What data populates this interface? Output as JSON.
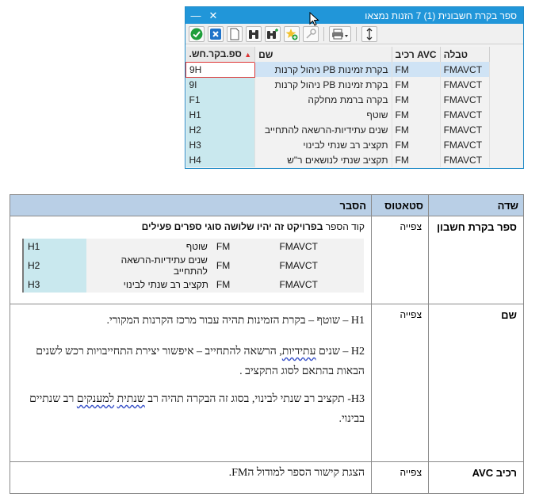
{
  "popup": {
    "title": "ספר בקרת חשבונית (1)   7 הזנות נמצאו",
    "grid": {
      "headers": {
        "code": ".ספ.בקר.חש",
        "name": "שם",
        "avc": "רכיב AVC",
        "table": "טבלה"
      },
      "rows": [
        {
          "code": "9H",
          "name": "ניהול קרנות PB בקרת זמינות",
          "avc": "FM",
          "table": "FMAVCT"
        },
        {
          "code": "9I",
          "name": "ניהול קרנות PB בקרת זמינות",
          "avc": "FM",
          "table": "FMAVCT"
        },
        {
          "code": "F1",
          "name": "בקרה ברמת מחלקה",
          "avc": "FM",
          "table": "FMAVCT"
        },
        {
          "code": "H1",
          "name": "שוטף",
          "avc": "FM",
          "table": "FMAVCT"
        },
        {
          "code": "H2",
          "name": "שנים עתידיות-הרשאה להתחייב",
          "avc": "FM",
          "table": "FMAVCT"
        },
        {
          "code": "H3",
          "name": "תקציב רב שנתי לבינוי",
          "avc": "FM",
          "table": "FMAVCT"
        },
        {
          "code": "H4",
          "name": "תקציב שנתי לנושאים ר\"ש",
          "avc": "FM",
          "table": "FMAVCT"
        }
      ]
    }
  },
  "spec": {
    "headers": {
      "field": "שדה",
      "status": "סטאטוס",
      "explanation": "הסבר"
    },
    "rows": [
      {
        "field": "ספר בקרת חשבון",
        "status": "צפייה",
        "intro_plain": "קוד הספר ",
        "intro_bold": "בפרויקט זה יהיו שלושה סוגי ספרים פעילים",
        "mini": [
          {
            "code": "H1",
            "name": "שוטף",
            "avc": "FM",
            "table": "FMAVCT"
          },
          {
            "code": "H2",
            "name": "שנים עתידיות-הרשאה להתחייב",
            "avc": "FM",
            "table": "FMAVCT"
          },
          {
            "code": "H3",
            "name": "תקציב רב שנתי לבינוי",
            "avc": "FM",
            "table": "FMAVCT"
          }
        ]
      },
      {
        "field": "שם",
        "status": "צפייה",
        "p1": "H1 – שוטף – בקרת הזמינות תהיה עבור מרכז הקרנות המקורי.",
        "p2a": "H2 – שנים ",
        "p2b": "עתידיות",
        "p2c": ", הרשאה להתחייב – איפשור יצירת התחייבויות רכש לשנים הבאות בהתאם לסוג התקציב .",
        "p3a": "H3-  תקציב רב שנתי לבינוי, בסוג זה הבקרה תהיה רב ",
        "p3b": "שנתית",
        "p3c": " ",
        "p3d": "למענקים",
        "p3e": " רב שנתיים בבינוי."
      },
      {
        "field": "רכיב AVC",
        "status": "צפייה",
        "text": "הצגת קישור הספר למודול הFM."
      }
    ]
  }
}
